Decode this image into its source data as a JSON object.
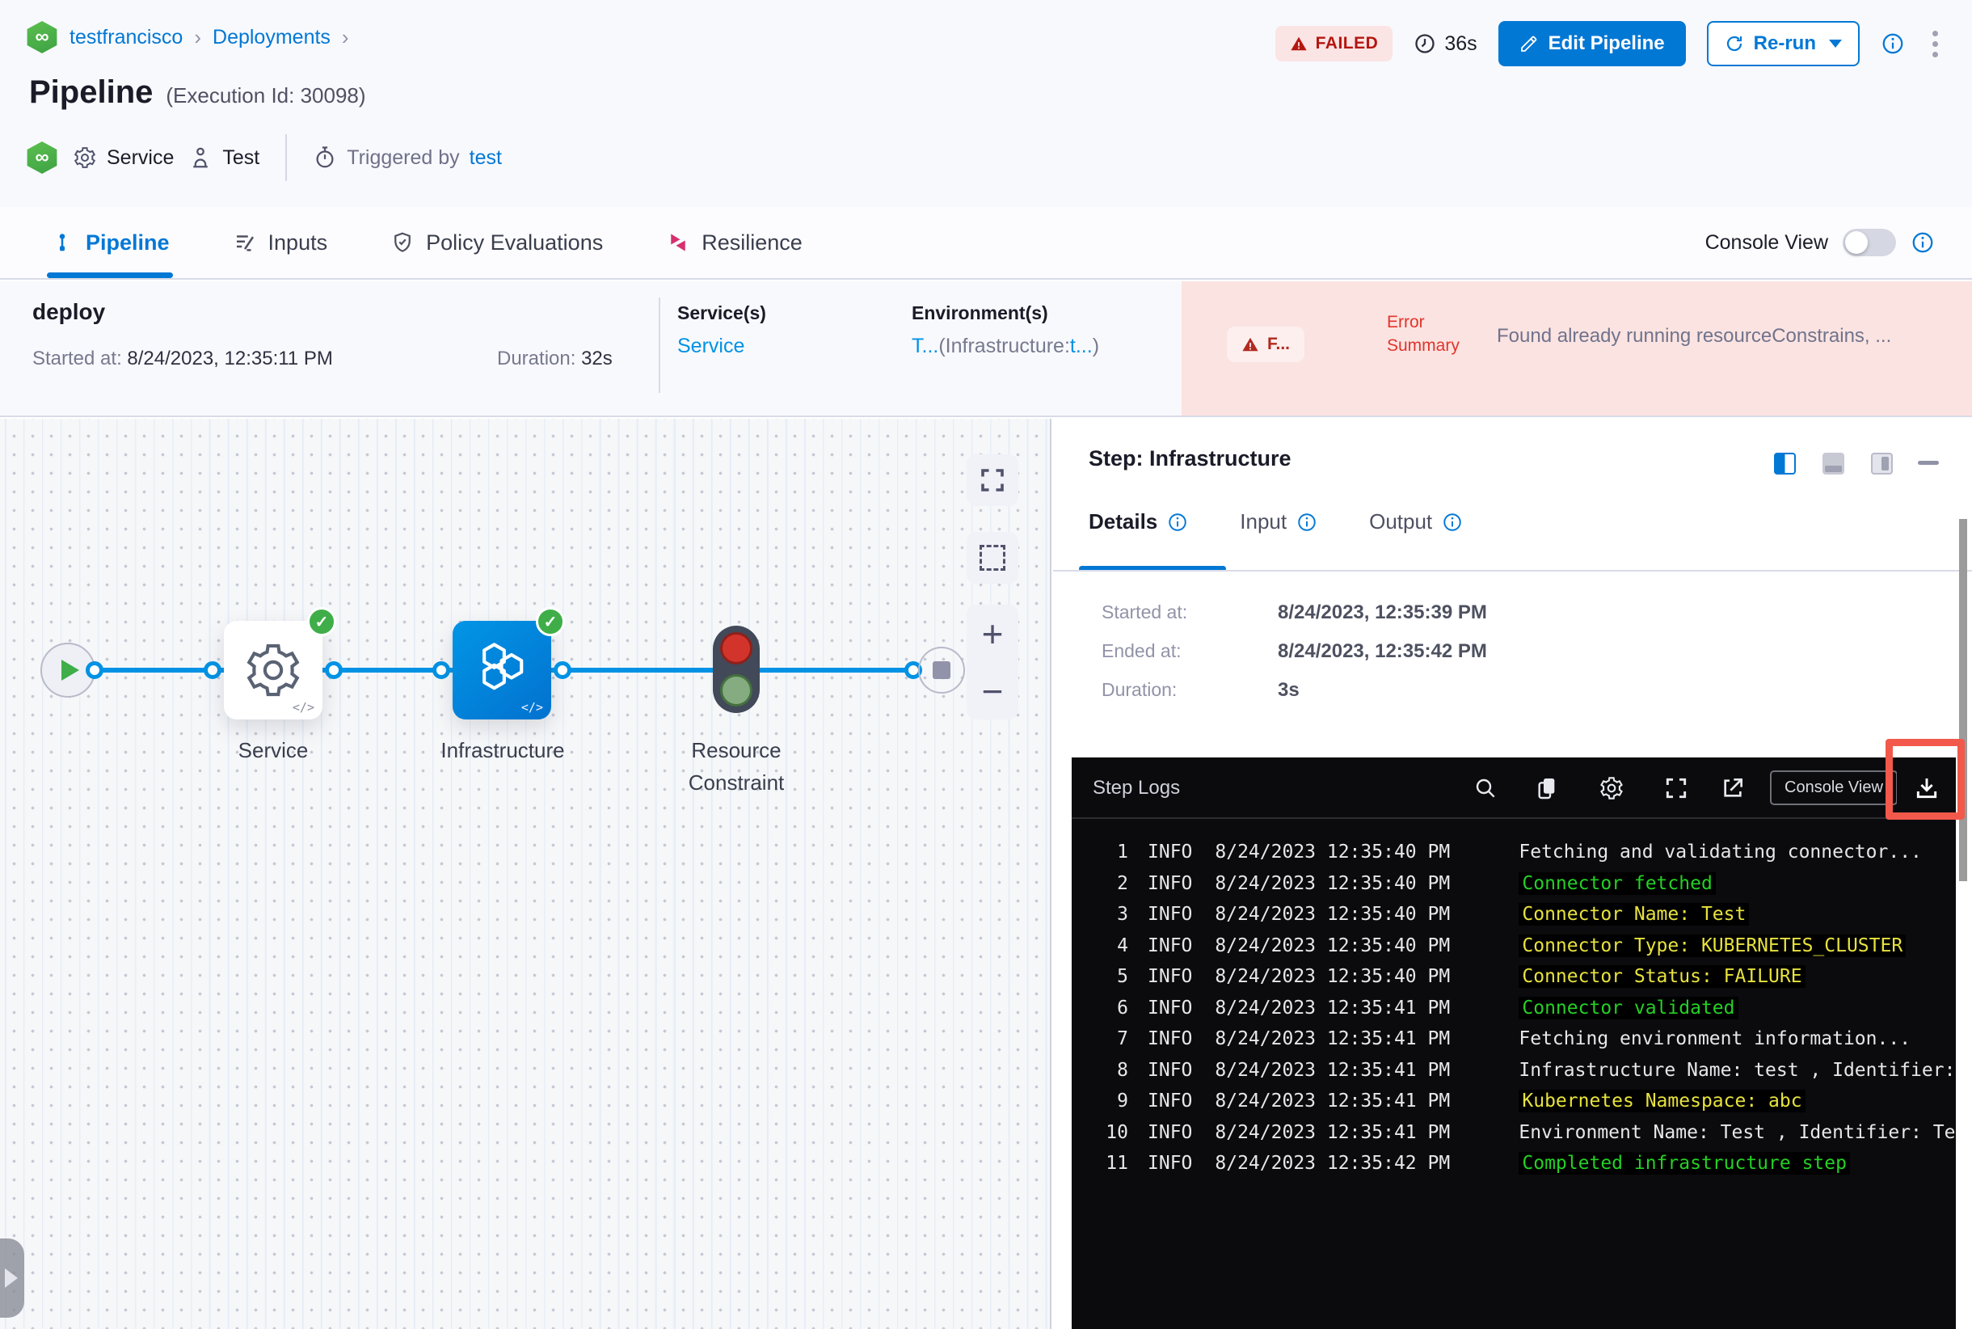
{
  "header": {
    "breadcrumb": {
      "project": "testfrancisco",
      "separator": "›",
      "section": "Deployments"
    },
    "title": "Pipeline",
    "execution_id": "(Execution Id: 30098)",
    "meta": {
      "service": "Service",
      "test": "Test",
      "triggered_by_label": "Triggered by",
      "triggered_by_value": "test"
    },
    "status_badge": "FAILED",
    "elapsed": "36s",
    "edit_pipeline_label": "Edit Pipeline",
    "rerun_label": "Re-run"
  },
  "tabbar": {
    "items": [
      "Pipeline",
      "Inputs",
      "Policy Evaluations",
      "Resilience"
    ],
    "console_view_label": "Console View"
  },
  "summary": {
    "stage_name": "deploy",
    "started_label": "Started at:",
    "started_value": "8/24/2023, 12:35:11 PM",
    "duration_label": "Duration:",
    "duration_value": "32s",
    "services_label": "Service(s)",
    "services_value": "Service",
    "environments_label": "Environment(s)",
    "environment_link": "T...",
    "environment_infra_prefix": "(Infrastructure:",
    "environment_infra_link": "t...",
    "environment_close": ")",
    "failed_chip": "F...",
    "error_summary_label": "Error Summary",
    "error_summary_text": "Found already running resourceConstrains, ..."
  },
  "graph": {
    "nodes": [
      {
        "label": "Service"
      },
      {
        "label": "Infrastructure"
      },
      {
        "label": "Resource Constraint"
      }
    ]
  },
  "panel": {
    "step_title": "Step: Infrastructure",
    "tabs": [
      "Details",
      "Input",
      "Output"
    ],
    "details": [
      {
        "label": "Started at:",
        "value": "8/24/2023, 12:35:39 PM"
      },
      {
        "label": "Ended at:",
        "value": "8/24/2023, 12:35:42 PM"
      },
      {
        "label": "Duration:",
        "value": "3s"
      }
    ],
    "logs": {
      "title": "Step Logs",
      "console_view_label": "Console View",
      "lines": [
        {
          "n": "1",
          "level": "INFO",
          "time": "8/24/2023 12:35:40 PM",
          "msg": "Fetching and validating connector...",
          "color": "white"
        },
        {
          "n": "2",
          "level": "INFO",
          "time": "8/24/2023 12:35:40 PM",
          "msg": "Connector fetched",
          "color": "green"
        },
        {
          "n": "3",
          "level": "INFO",
          "time": "8/24/2023 12:35:40 PM",
          "msg": "Connector Name: Test",
          "color": "yellow"
        },
        {
          "n": "4",
          "level": "INFO",
          "time": "8/24/2023 12:35:40 PM",
          "msg": "Connector Type: KUBERNETES_CLUSTER",
          "color": "yellow"
        },
        {
          "n": "5",
          "level": "INFO",
          "time": "8/24/2023 12:35:40 PM",
          "msg": "Connector Status: FAILURE",
          "color": "yellow"
        },
        {
          "n": "6",
          "level": "INFO",
          "time": "8/24/2023 12:35:41 PM",
          "msg": "Connector validated",
          "color": "green"
        },
        {
          "n": "7",
          "level": "INFO",
          "time": "8/24/2023 12:35:41 PM",
          "msg": "Fetching environment information...",
          "color": "white"
        },
        {
          "n": "8",
          "level": "INFO",
          "time": "8/24/2023 12:35:41 PM",
          "msg": "Infrastructure Name: test , Identifier:",
          "color": "white"
        },
        {
          "n": "9",
          "level": "INFO",
          "time": "8/24/2023 12:35:41 PM",
          "msg": "Kubernetes Namespace: abc",
          "color": "yellow"
        },
        {
          "n": "10",
          "level": "INFO",
          "time": "8/24/2023 12:35:41 PM",
          "msg": "Environment Name: Test , Identifier: Te",
          "color": "white"
        },
        {
          "n": "11",
          "level": "INFO",
          "time": "8/24/2023 12:35:42 PM",
          "msg": "Completed infrastructure step",
          "color": "green"
        }
      ]
    }
  },
  "colors": {
    "accent": "#0278d5",
    "link": "#0092e4",
    "failed_red": "#b41710",
    "error_band": "#fbe3e1",
    "success_green": "#3fae49",
    "log_green": "#25d025",
    "log_yellow": "#e7e23e",
    "highlight_red": "#f2594b"
  }
}
